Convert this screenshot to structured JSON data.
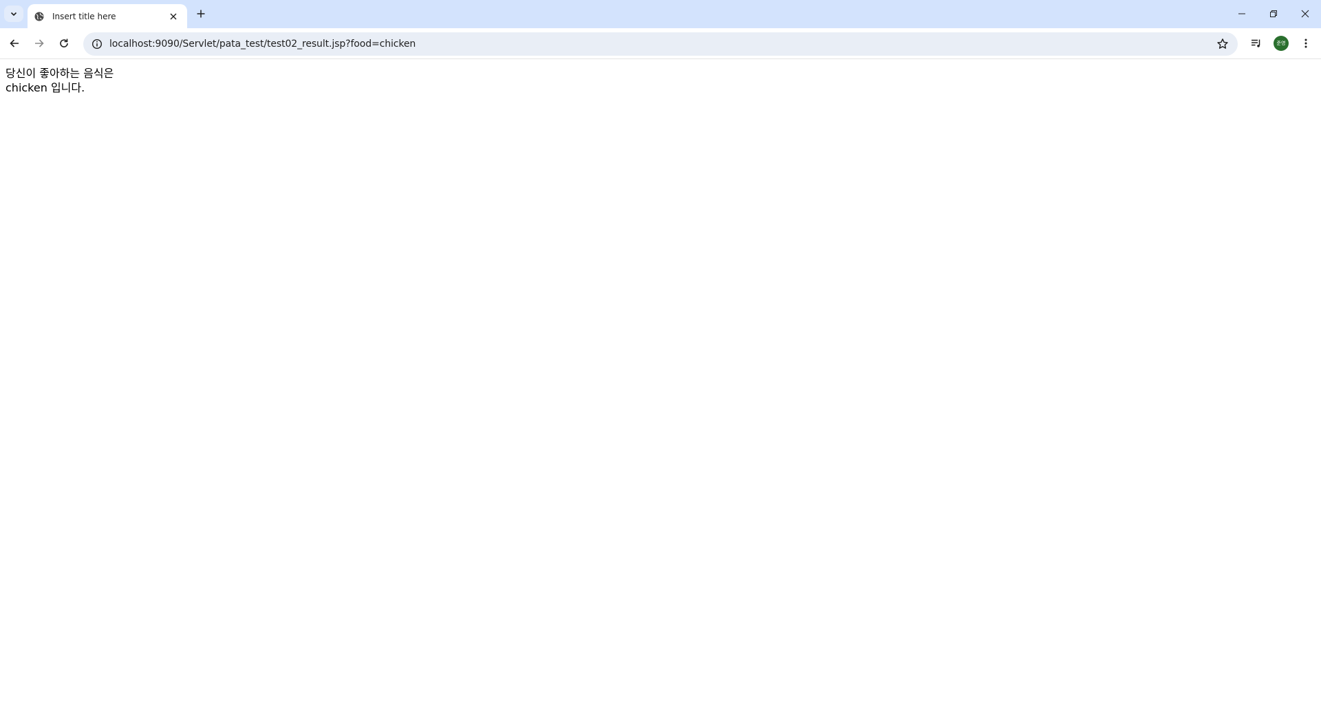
{
  "browser": {
    "tab": {
      "title": "Insert title here"
    },
    "address_bar": {
      "url": "localhost:9090/Servlet/pata_test/test02_result.jsp?food=chicken"
    },
    "profile": {
      "initials": "준영"
    }
  },
  "page": {
    "line1": "당신이 좋아하는 음식은",
    "line2": "chicken 입니다."
  },
  "icons": {
    "tab_search": "chevron-down-icon",
    "favicon": "globe-icon",
    "tab_close": "close-icon",
    "new_tab": "plus-icon",
    "back": "arrow-left-icon",
    "forward": "arrow-right-icon",
    "reload": "reload-icon",
    "site_info": "info-icon",
    "bookmark": "star-icon",
    "media": "media-queue-icon",
    "menu": "kebab-menu-icon",
    "minimize": "minimize-icon",
    "restore": "restore-icon",
    "close_window": "close-window-icon"
  },
  "colors": {
    "tabstrip": "#d3e3fd",
    "omnibox": "#e9eef6",
    "avatar": "#2a6f2e"
  }
}
